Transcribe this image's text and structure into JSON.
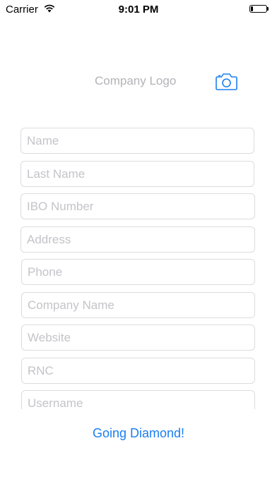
{
  "status_bar": {
    "carrier": "Carrier",
    "time": "9:01 PM",
    "wifi_icon": "wifi-icon",
    "battery_icon": "battery-icon"
  },
  "header": {
    "logo_label": "Company Logo",
    "camera_icon": "camera-icon"
  },
  "form": {
    "fields": [
      {
        "placeholder": "Name",
        "value": ""
      },
      {
        "placeholder": "Last Name",
        "value": ""
      },
      {
        "placeholder": "IBO Number",
        "value": ""
      },
      {
        "placeholder": "Address",
        "value": ""
      },
      {
        "placeholder": "Phone",
        "value": ""
      },
      {
        "placeholder": "Company Name",
        "value": ""
      },
      {
        "placeholder": "Website",
        "value": ""
      },
      {
        "placeholder": "RNC",
        "value": ""
      },
      {
        "placeholder": "Username",
        "value": ""
      }
    ]
  },
  "submit_label": "Going Diamond!",
  "colors": {
    "accent": "#1b7ef0",
    "placeholder": "#c4c4c9",
    "field_border": "#dcdce0",
    "logo_text": "#b3b3b8"
  }
}
